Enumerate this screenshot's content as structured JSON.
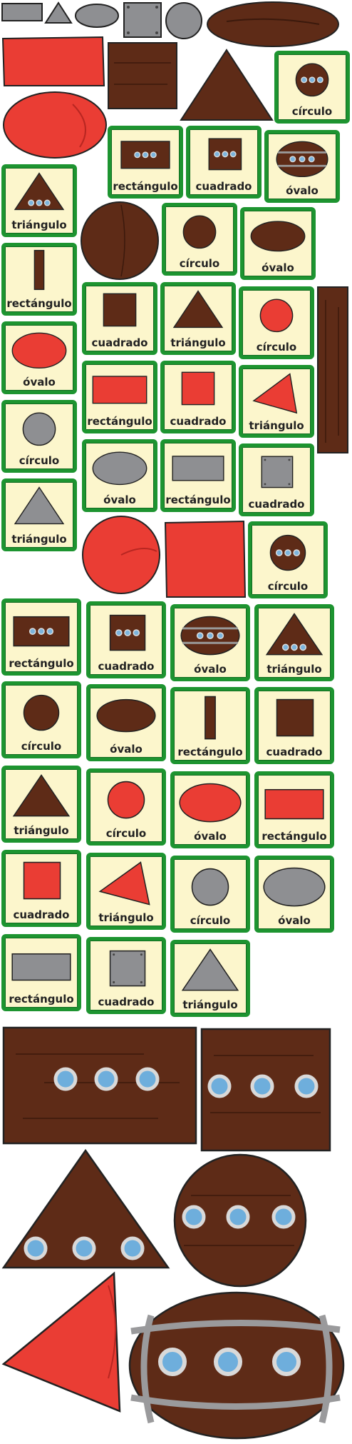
{
  "labels": {
    "circle": "círculo",
    "rectangle": "rectángulo",
    "square": "cuadrado",
    "oval": "óvalo",
    "triangle": "triángulo"
  },
  "colors": {
    "wood": "#5e2b17",
    "wood_line": "#3b190c",
    "red": "#ea3d34",
    "gray": "#8e8f92",
    "card_bg": "#fcf6cc",
    "card_border": "#1d9430"
  }
}
